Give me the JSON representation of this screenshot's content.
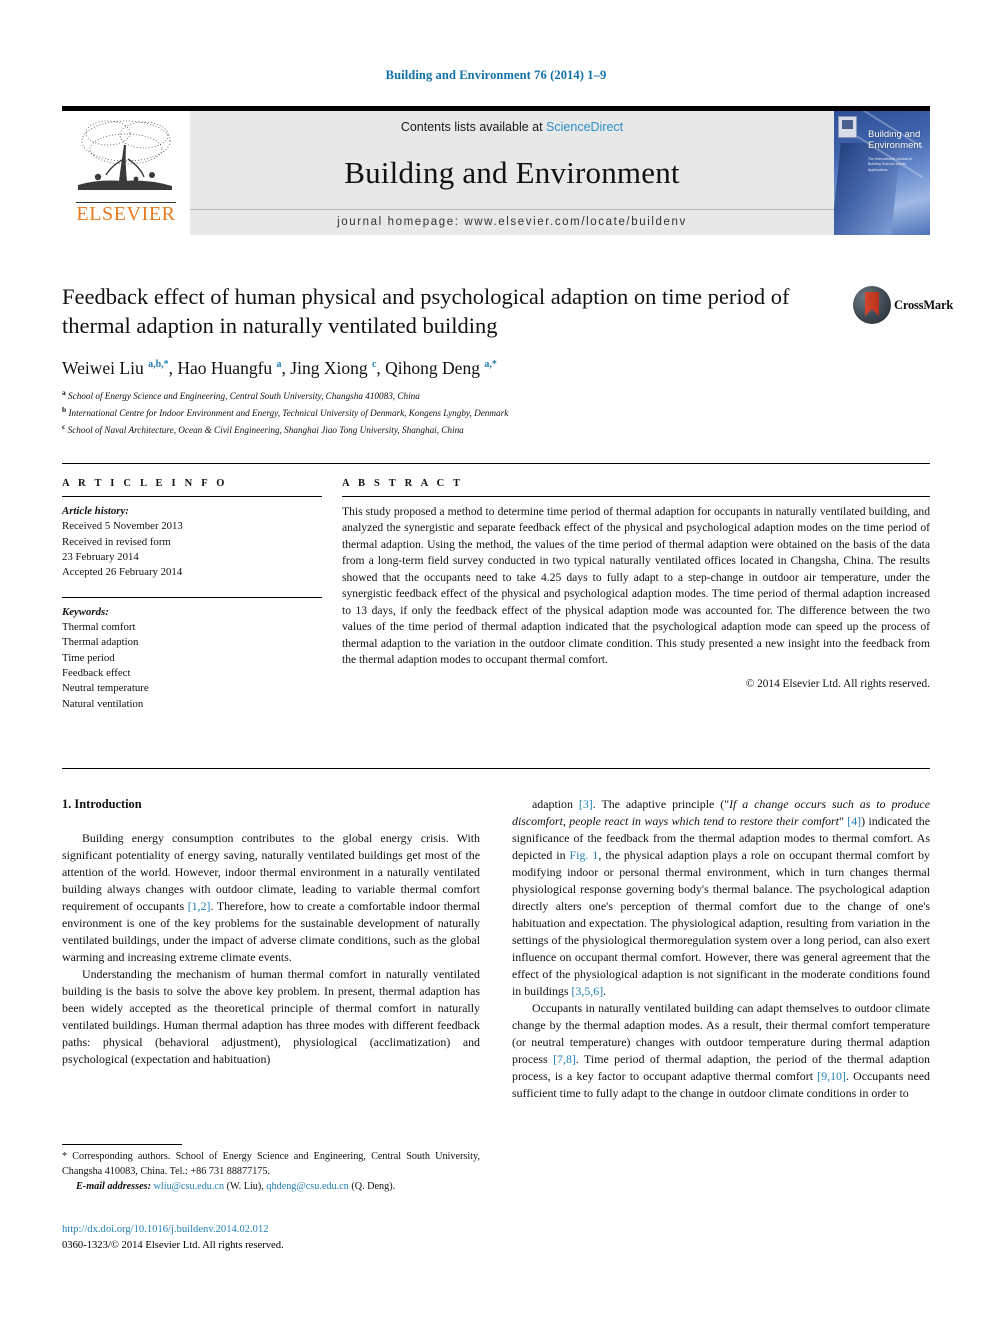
{
  "running_head": "Building and Environment 76 (2014) 1–9",
  "masthead": {
    "contents_prefix": "Contents lists available at ",
    "sciencedirect": "ScienceDirect",
    "journal_name": "Building and Environment",
    "homepage": "journal homepage: www.elsevier.com/locate/buildenv",
    "publisher": "ELSEVIER",
    "cover_title": "Building and Environment",
    "cover_subtitle": "The International Journal of Building Science and its Applications"
  },
  "article": {
    "title": "Feedback effect of human physical and psychological adaption on time period of thermal adaption in naturally ventilated building",
    "crossmark_label": "CrossMark",
    "authors_html": "Weiwei Liu <sup>a,b,*</sup>, Hao Huangfu <sup>a</sup>, Jing Xiong <sup>c</sup>, Qihong Deng <sup>a,*</sup>",
    "affiliations": [
      {
        "marker": "a",
        "text": "School of Energy Science and Engineering, Central South University, Changsha 410083, China"
      },
      {
        "marker": "b",
        "text": "International Centre for Indoor Environment and Energy, Technical University of Denmark, Kongens Lyngby, Denmark"
      },
      {
        "marker": "c",
        "text": "School of Naval Architecture, Ocean & Civil Engineering, Shanghai Jiao Tong University, Shanghai, China"
      }
    ]
  },
  "info": {
    "heading": "A R T I C L E   I N F O",
    "history_label": "Article history:",
    "history": [
      "Received 5 November 2013",
      "Received in revised form",
      "23 February 2014",
      "Accepted 26 February 2014"
    ],
    "keywords_label": "Keywords:",
    "keywords": [
      "Thermal comfort",
      "Thermal adaption",
      "Time period",
      "Feedback effect",
      "Neutral temperature",
      "Natural ventilation"
    ]
  },
  "abstract": {
    "heading": "A B S T R A C T",
    "text": "This study proposed a method to determine time period of thermal adaption for occupants in naturally ventilated building, and analyzed the synergistic and separate feedback effect of the physical and psychological adaption modes on the time period of thermal adaption. Using the method, the values of the time period of thermal adaption were obtained on the basis of the data from a long-term field survey conducted in two typical naturally ventilated offices located in Changsha, China. The results showed that the occupants need to take 4.25 days to fully adapt to a step-change in outdoor air temperature, under the synergistic feedback effect of the physical and psychological adaption modes. The time period of thermal adaption increased to 13 days, if only the feedback effect of the physical adaption mode was accounted for. The difference between the two values of the time period of thermal adaption indicated that the psychological adaption mode can speed up the process of thermal adaption to the variation in the outdoor climate condition. This study presented a new insight into the feedback from the thermal adaption modes to occupant thermal comfort.",
    "copyright": "© 2014 Elsevier Ltd. All rights reserved."
  },
  "body": {
    "section_heading": "1. Introduction",
    "left_paragraphs": [
      "Building energy consumption contributes to the global energy crisis. With significant potentiality of energy saving, naturally ventilated buildings get most of the attention of the world. However, indoor thermal environment in a naturally ventilated building always changes with outdoor climate, leading to variable thermal comfort requirement of occupants [1,2]. Therefore, how to create a comfortable indoor thermal environment is one of the key problems for the sustainable development of naturally ventilated buildings, under the impact of adverse climate conditions, such as the global warming and increasing extreme climate events.",
      "Understanding the mechanism of human thermal comfort in naturally ventilated building is the basis to solve the above key problem. In present, thermal adaption has been widely accepted as the theoretical principle of thermal comfort in naturally ventilated buildings. Human thermal adaption has three modes with different feedback paths: physical (behavioral adjustment), physiological (acclimatization) and psychological (expectation and habituation)"
    ],
    "right_paragraphs": [
      "adaption [3]. The adaptive principle (\"If a change occurs such as to produce discomfort, people react in ways which tend to restore their comfort\" [4]) indicated the significance of the feedback from the thermal adaption modes to thermal comfort. As depicted in Fig. 1, the physical adaption plays a role on occupant thermal comfort by modifying indoor or personal thermal environment, which in turn changes thermal physiological response governing body's thermal balance. The psychological adaption directly alters one's perception of thermal comfort due to the change of one's habituation and expectation. The physiological adaption, resulting from variation in the settings of the physiological thermoregulation system over a long period, can also exert influence on occupant thermal comfort. However, there was general agreement that the effect of the physiological adaption is not significant in the moderate conditions found in buildings [3,5,6].",
      "Occupants in naturally ventilated building can adapt themselves to outdoor climate change by the thermal adaption modes. As a result, their thermal comfort temperature (or neutral temperature) changes with outdoor temperature during thermal adaption process [7,8]. Time period of thermal adaption, the period of the thermal adaption process, is a key factor to occupant adaptive thermal comfort [9,10]. Occupants need sufficient time to fully adapt to the change in outdoor climate conditions in order to"
    ]
  },
  "footnotes": {
    "corresponding": "* Corresponding authors. School of Energy Science and Engineering, Central South University, Changsha 410083, China. Tel.: +86 731 88877175.",
    "email_label": "E-mail addresses:",
    "email1": "wliu@csu.edu.cn",
    "email1_owner": "(W. Liu),",
    "email2": "qhdeng@csu.edu.cn",
    "email2_owner": "(Q. Deng)."
  },
  "doi_block": {
    "doi": "http://dx.doi.org/10.1016/j.buildenv.2014.02.012",
    "issn_line": "0360-1323/© 2014 Elsevier Ltd. All rights reserved."
  },
  "colors": {
    "link_blue": "#1f7fb5",
    "sciencedirect_blue": "#2b8fc9",
    "elsevier_orange": "#E87B1E"
  }
}
